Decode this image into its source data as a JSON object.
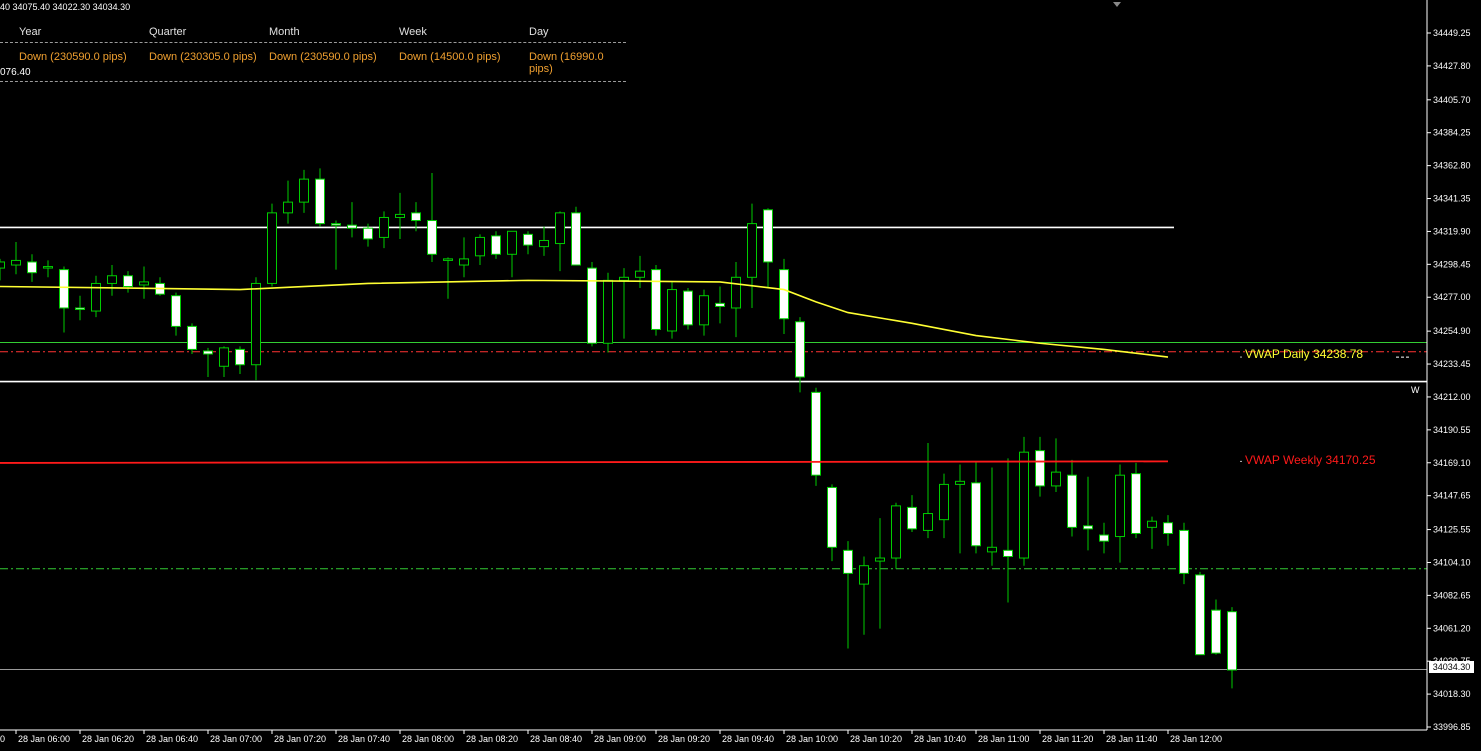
{
  "ohlc_header": "40 34075.40 34022.30 34034.30",
  "timeframes": {
    "headers": [
      "Year",
      "Quarter",
      "Month",
      "Week",
      "Day"
    ],
    "values": [
      "Down (230590.0 pips)",
      "Down (230305.0 pips)",
      "Down (230590.0 pips)",
      "Down (14500.0 pips)",
      "Down (16990.0 pips)"
    ]
  },
  "partial_price": "076.40",
  "vwap_daily_label": "VWAP Daily 34238.78",
  "vwap_weekly_label": "VWAP Weekly 34170.25",
  "w_marker": "W",
  "current_price": "34034.30",
  "colors": {
    "background": "#000000",
    "candle_up": "#000000",
    "candle_down": "#ffffff",
    "wick": "#00cc00",
    "vwap_daily": "#ffff33",
    "vwap_weekly": "#ff1a1a",
    "level_white": "#ffffff",
    "level_green": "#33cc33",
    "level_red_dash": "#ff3333",
    "axis_text": "#ffffff",
    "timeframe_value": "#f0a030"
  },
  "chart_data": {
    "type": "candlestick",
    "price_axis_labels": [
      "34449.25",
      "34427.80",
      "34405.70",
      "34384.25",
      "34362.80",
      "34341.35",
      "34319.90",
      "34298.45",
      "34277.00",
      "34254.90",
      "34233.45",
      "34212.00",
      "34190.55",
      "34169.10",
      "34147.65",
      "34125.55",
      "34104.10",
      "34082.65",
      "34061.20",
      "34039.75",
      "34018.30",
      "33996.85"
    ],
    "ylim": [
      33990,
      34470
    ],
    "time_axis_labels": [
      "28 Jan 06:00",
      "28 Jan 06:20",
      "28 Jan 06:40",
      "28 Jan 07:00",
      "28 Jan 07:20",
      "28 Jan 07:40",
      "28 Jan 08:00",
      "28 Jan 08:20",
      "28 Jan 08:40",
      "28 Jan 09:00",
      "28 Jan 09:20",
      "28 Jan 09:40",
      "28 Jan 10:00",
      "28 Jan 10:20",
      "28 Jan 10:40",
      "28 Jan 11:00",
      "28 Jan 11:20",
      "28 Jan 11:40",
      "28 Jan 12:00"
    ],
    "start_time": "05:55",
    "bar_minutes": 5,
    "candles": [
      {
        "o": 34296,
        "h": 34302,
        "l": 34288,
        "c": 34300
      },
      {
        "o": 34298,
        "h": 34313,
        "l": 34292,
        "c": 34301
      },
      {
        "o": 34300,
        "h": 34305,
        "l": 34287,
        "c": 34293
      },
      {
        "o": 34297,
        "h": 34301,
        "l": 34290,
        "c": 34297
      },
      {
        "o": 34295,
        "h": 34297,
        "l": 34254,
        "c": 34270
      },
      {
        "o": 34270,
        "h": 34278,
        "l": 34262,
        "c": 34269
      },
      {
        "o": 34268,
        "h": 34291,
        "l": 34264,
        "c": 34286
      },
      {
        "o": 34286,
        "h": 34298,
        "l": 34278,
        "c": 34291
      },
      {
        "o": 34291,
        "h": 34294,
        "l": 34280,
        "c": 34284
      },
      {
        "o": 34285,
        "h": 34297,
        "l": 34276,
        "c": 34287
      },
      {
        "o": 34286,
        "h": 34290,
        "l": 34278,
        "c": 34279
      },
      {
        "o": 34278,
        "h": 34280,
        "l": 34252,
        "c": 34258
      },
      {
        "o": 34258,
        "h": 34260,
        "l": 34240,
        "c": 34243
      },
      {
        "o": 34242,
        "h": 34244,
        "l": 34225,
        "c": 34240
      },
      {
        "o": 34232,
        "h": 34245,
        "l": 34225,
        "c": 34244
      },
      {
        "o": 34243,
        "h": 34245,
        "l": 34227,
        "c": 34233
      },
      {
        "o": 34233,
        "h": 34290,
        "l": 34223,
        "c": 34286
      },
      {
        "o": 34286,
        "h": 34338,
        "l": 34284,
        "c": 34332
      },
      {
        "o": 34332,
        "h": 34353,
        "l": 34325,
        "c": 34339
      },
      {
        "o": 34339,
        "h": 34360,
        "l": 34332,
        "c": 34354
      },
      {
        "o": 34354,
        "h": 34361,
        "l": 34323,
        "c": 34325
      },
      {
        "o": 34325,
        "h": 34327,
        "l": 34295,
        "c": 34324
      },
      {
        "o": 34324,
        "h": 34339,
        "l": 34316,
        "c": 34322
      },
      {
        "o": 34322,
        "h": 34325,
        "l": 34310,
        "c": 34315
      },
      {
        "o": 34316,
        "h": 34333,
        "l": 34309,
        "c": 34329
      },
      {
        "o": 34329,
        "h": 34345,
        "l": 34315,
        "c": 34331
      },
      {
        "o": 34332,
        "h": 34339,
        "l": 34320,
        "c": 34327
      },
      {
        "o": 34327,
        "h": 34358,
        "l": 34300,
        "c": 34305
      },
      {
        "o": 34301,
        "h": 34303,
        "l": 34276,
        "c": 34302
      },
      {
        "o": 34298,
        "h": 34316,
        "l": 34290,
        "c": 34302
      },
      {
        "o": 34304,
        "h": 34318,
        "l": 34298,
        "c": 34316
      },
      {
        "o": 34317,
        "h": 34320,
        "l": 34302,
        "c": 34305
      },
      {
        "o": 34305,
        "h": 34318,
        "l": 34290,
        "c": 34320
      },
      {
        "o": 34318,
        "h": 34320,
        "l": 34305,
        "c": 34311
      },
      {
        "o": 34310,
        "h": 34323,
        "l": 34304,
        "c": 34314
      },
      {
        "o": 34312,
        "h": 34333,
        "l": 34294,
        "c": 34332
      },
      {
        "o": 34332,
        "h": 34336,
        "l": 34298,
        "c": 34298
      },
      {
        "o": 34296,
        "h": 34300,
        "l": 34245,
        "c": 34247
      },
      {
        "o": 34247,
        "h": 34293,
        "l": 34241,
        "c": 34288
      },
      {
        "o": 34288,
        "h": 34296,
        "l": 34250,
        "c": 34290
      },
      {
        "o": 34290,
        "h": 34304,
        "l": 34283,
        "c": 34294
      },
      {
        "o": 34295,
        "h": 34298,
        "l": 34252,
        "c": 34256
      },
      {
        "o": 34255,
        "h": 34287,
        "l": 34250,
        "c": 34282
      },
      {
        "o": 34281,
        "h": 34283,
        "l": 34256,
        "c": 34259
      },
      {
        "o": 34259,
        "h": 34282,
        "l": 34252,
        "c": 34278
      },
      {
        "o": 34273,
        "h": 34284,
        "l": 34260,
        "c": 34271
      },
      {
        "o": 34270,
        "h": 34300,
        "l": 34251,
        "c": 34290
      },
      {
        "o": 34290,
        "h": 34338,
        "l": 34270,
        "c": 34325
      },
      {
        "o": 34334,
        "h": 34335,
        "l": 34283,
        "c": 34300
      },
      {
        "o": 34295,
        "h": 34302,
        "l": 34253,
        "c": 34263
      },
      {
        "o": 34261,
        "h": 34264,
        "l": 34215,
        "c": 34225
      },
      {
        "o": 34215,
        "h": 34218,
        "l": 34154,
        "c": 34161
      },
      {
        "o": 34153,
        "h": 34155,
        "l": 34105,
        "c": 34114
      },
      {
        "o": 34112,
        "h": 34118,
        "l": 34048,
        "c": 34097
      },
      {
        "o": 34090,
        "h": 34108,
        "l": 34057,
        "c": 34102
      },
      {
        "o": 34105,
        "h": 34133,
        "l": 34061,
        "c": 34107
      },
      {
        "o": 34107,
        "h": 34143,
        "l": 34100,
        "c": 34141
      },
      {
        "o": 34140,
        "h": 34148,
        "l": 34124,
        "c": 34126
      },
      {
        "o": 34125,
        "h": 34182,
        "l": 34120,
        "c": 34136
      },
      {
        "o": 34132,
        "h": 34162,
        "l": 34120,
        "c": 34155
      },
      {
        "o": 34155,
        "h": 34168,
        "l": 34110,
        "c": 34157
      },
      {
        "o": 34156,
        "h": 34170,
        "l": 34110,
        "c": 34115
      },
      {
        "o": 34111,
        "h": 34166,
        "l": 34102,
        "c": 34114
      },
      {
        "o": 34112,
        "h": 34172,
        "l": 34078,
        "c": 34108
      },
      {
        "o": 34107,
        "h": 34186,
        "l": 34102,
        "c": 34176
      },
      {
        "o": 34177,
        "h": 34186,
        "l": 34147,
        "c": 34154
      },
      {
        "o": 34154,
        "h": 34185,
        "l": 34150,
        "c": 34163
      },
      {
        "o": 34161,
        "h": 34171,
        "l": 34121,
        "c": 34127
      },
      {
        "o": 34128,
        "h": 34160,
        "l": 34112,
        "c": 34126
      },
      {
        "o": 34122,
        "h": 34130,
        "l": 34110,
        "c": 34118
      },
      {
        "o": 34121,
        "h": 34168,
        "l": 34104,
        "c": 34161
      },
      {
        "o": 34162,
        "h": 34169,
        "l": 34120,
        "c": 34123
      },
      {
        "o": 34127,
        "h": 34134,
        "l": 34113,
        "c": 34131
      },
      {
        "o": 34130,
        "h": 34135,
        "l": 34115,
        "c": 34123
      },
      {
        "o": 34125,
        "h": 34130,
        "l": 34090,
        "c": 34097
      },
      {
        "o": 34096,
        "h": 34098,
        "l": 34045,
        "c": 34044
      },
      {
        "o": 34073,
        "h": 34080,
        "l": 34044,
        "c": 34045
      },
      {
        "o": 34072,
        "h": 34075,
        "l": 34022,
        "c": 34034
      }
    ],
    "vwap_daily": [
      {
        "time": "05:55",
        "value": 34284
      },
      {
        "time": "06:35",
        "value": 34283
      },
      {
        "time": "07:10",
        "value": 34282
      },
      {
        "time": "07:50",
        "value": 34286
      },
      {
        "time": "08:40",
        "value": 34288
      },
      {
        "time": "09:40",
        "value": 34287
      },
      {
        "time": "10:00",
        "value": 34282
      },
      {
        "time": "10:10",
        "value": 34274
      },
      {
        "time": "10:20",
        "value": 34267
      },
      {
        "time": "10:40",
        "value": 34260
      },
      {
        "time": "11:00",
        "value": 34252
      },
      {
        "time": "11:20",
        "value": 34247
      },
      {
        "time": "11:40",
        "value": 34243
      },
      {
        "time": "12:00",
        "value": 34238
      }
    ],
    "vwap_weekly": [
      {
        "time": "05:55",
        "value": 34169
      },
      {
        "time": "12:00",
        "value": 34170
      }
    ],
    "levels": [
      {
        "price": 34322.5,
        "style": "solid-white",
        "end_time": "12:00"
      },
      {
        "price": 34247.5,
        "style": "solid-green",
        "end_time": "edge"
      },
      {
        "price": 34241.5,
        "style": "dash-dot-red",
        "end_time": "edge"
      },
      {
        "price": 34222.0,
        "style": "solid-white",
        "end_time": "edge"
      },
      {
        "price": 34100.0,
        "style": "dash-dot-green",
        "end_time": "edge"
      },
      {
        "price": 34034.3,
        "style": "solid-gray",
        "end_time": "edge"
      }
    ]
  }
}
